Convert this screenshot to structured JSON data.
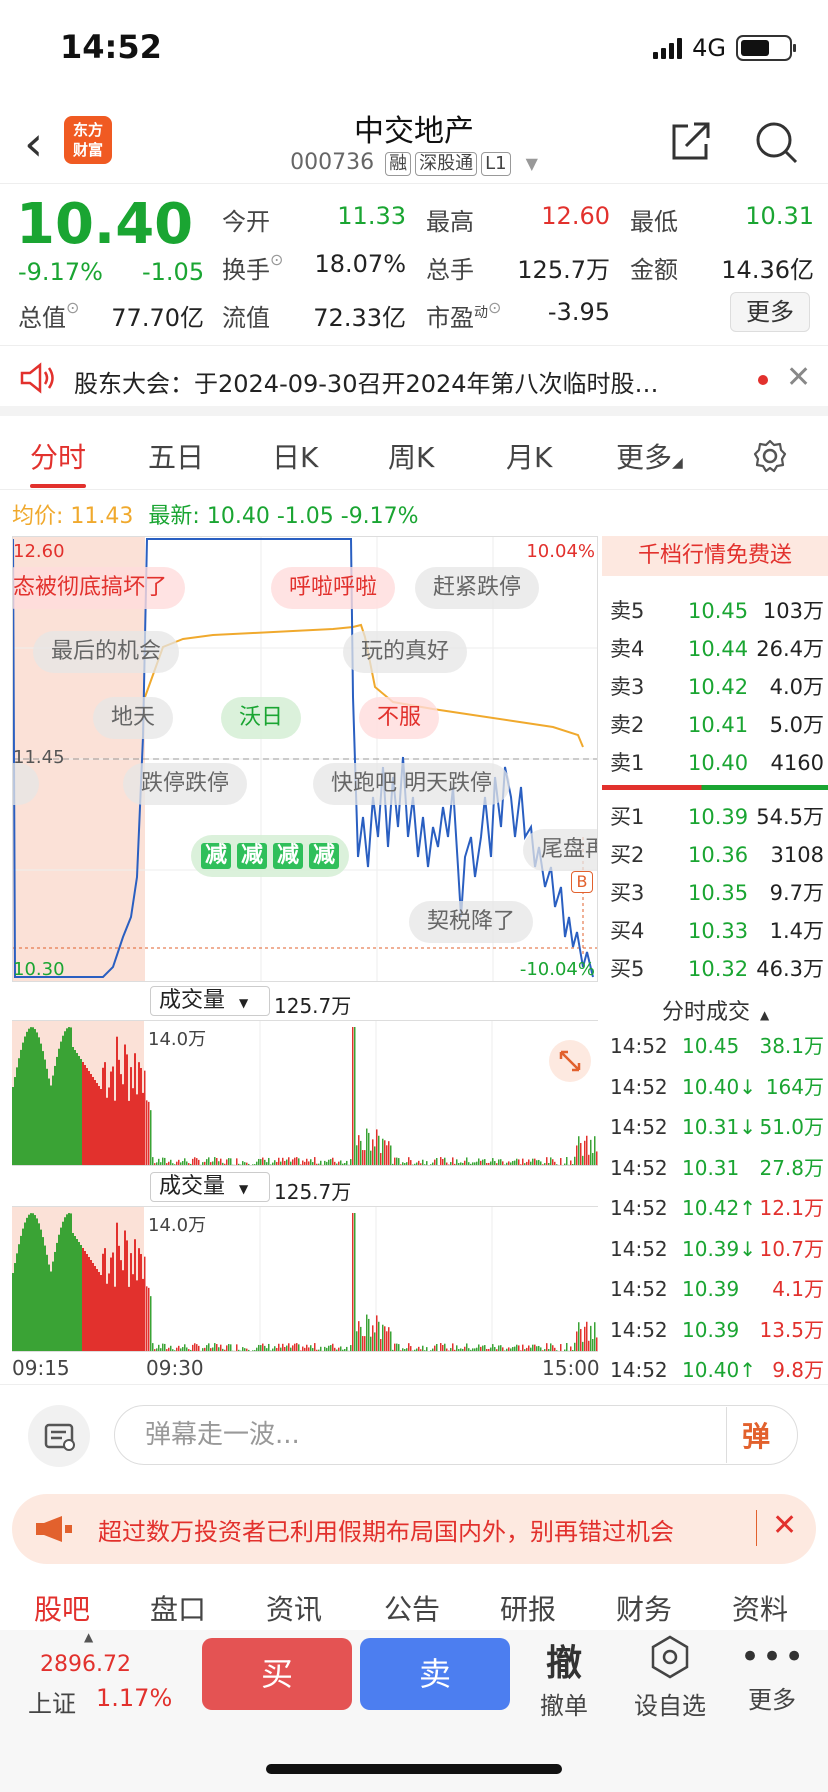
{
  "status_bar": {
    "time": "14:52",
    "network": "4G"
  },
  "header": {
    "back_icon": "chevron-left-icon",
    "logo_line1": "东方",
    "logo_line2": "财富",
    "name": "中交地产",
    "code": "000736",
    "tags": [
      "融",
      "深股通",
      "L1"
    ],
    "share_icon": "share-icon",
    "search_icon": "search-icon"
  },
  "quote": {
    "price": "10.40",
    "change_pct": "-9.17%",
    "change": "-1.05",
    "open_label": "今开",
    "open": "11.33",
    "high_label": "最高",
    "high": "12.60",
    "low_label": "最低",
    "low": "10.31",
    "turnover_label": "换手",
    "turnover": "18.07%",
    "vol_label": "总手",
    "vol": "125.7万",
    "amount_label": "金额",
    "amount": "14.36亿",
    "mktcap_label": "总值",
    "mktcap": "77.70亿",
    "float_label": "流值",
    "float": "72.33亿",
    "pe_label": "市盈",
    "pe_sup": "动",
    "pe": "-3.95",
    "more_label": "更多"
  },
  "notice": {
    "text": "股东大会：于2024-09-30召开2024年第八次临时股…"
  },
  "tabs": [
    {
      "label": "分时"
    },
    {
      "label": "五日"
    },
    {
      "label": "日K"
    },
    {
      "label": "周K"
    },
    {
      "label": "月K"
    },
    {
      "label": "更多"
    }
  ],
  "avg_line": {
    "avg_label": "均价:",
    "avg_val": "11.43",
    "latest_label": "最新:",
    "latest_val": "10.40",
    "latest_chg": "-1.05",
    "latest_pct": "-9.17%"
  },
  "chart_labels": {
    "top_left": "12.60",
    "top_right": "10.04%",
    "mid_left": "11.45",
    "bottom_left": "10.30",
    "bottom_right": "-10.04%",
    "marker_b": "B"
  },
  "danmu": [
    "态被彻底搞坏了",
    "呼啦呼啦",
    "赶紧跌停",
    "最后的机会",
    "玩的真好",
    "地天",
    "沃日",
    "不服",
    "跌停跌停",
    "快跑吧",
    "明天跌停",
    "尾盘再",
    "契税降了",
    "减",
    "减",
    "减",
    "减"
  ],
  "order_book": {
    "header": "千档行情免费送",
    "asks": [
      {
        "label": "卖5",
        "price": "10.45",
        "vol": "103万"
      },
      {
        "label": "卖4",
        "price": "10.44",
        "vol": "26.4万"
      },
      {
        "label": "卖3",
        "price": "10.42",
        "vol": "4.0万"
      },
      {
        "label": "卖2",
        "price": "10.41",
        "vol": "5.0万"
      },
      {
        "label": "卖1",
        "price": "10.40",
        "vol": "4160"
      }
    ],
    "bids": [
      {
        "label": "买1",
        "price": "10.39",
        "vol": "54.5万"
      },
      {
        "label": "买2",
        "price": "10.36",
        "vol": "3108"
      },
      {
        "label": "买3",
        "price": "10.35",
        "vol": "9.7万"
      },
      {
        "label": "买4",
        "price": "10.33",
        "vol": "1.4万"
      },
      {
        "label": "买5",
        "price": "10.32",
        "vol": "46.3万"
      }
    ],
    "ticks_header": "分时成交",
    "ticks": [
      {
        "time": "14:52",
        "price": "10.45",
        "vol": "38.1万",
        "pc": "green",
        "vc": "green"
      },
      {
        "time": "14:52",
        "price": "10.40↓",
        "vol": "164万",
        "pc": "green",
        "vc": "green"
      },
      {
        "time": "14:52",
        "price": "10.31↓",
        "vol": "51.0万",
        "pc": "green",
        "vc": "green"
      },
      {
        "time": "14:52",
        "price": "10.31",
        "vol": "27.8万",
        "pc": "green",
        "vc": "green"
      },
      {
        "time": "14:52",
        "price": "10.42↑",
        "vol": "12.1万",
        "pc": "green",
        "vc": "red"
      },
      {
        "time": "14:52",
        "price": "10.39↓",
        "vol": "10.7万",
        "pc": "green",
        "vc": "red"
      },
      {
        "time": "14:52",
        "price": "10.39",
        "vol": "4.1万",
        "pc": "green",
        "vc": "red"
      },
      {
        "time": "14:52",
        "price": "10.39",
        "vol": "13.5万",
        "pc": "green",
        "vc": "red"
      },
      {
        "time": "14:52",
        "price": "10.40↑",
        "vol": "9.8万",
        "pc": "green",
        "vc": "red"
      }
    ]
  },
  "volume": {
    "label": "成交量",
    "total": "125.7万",
    "max": "14.0万"
  },
  "time_axis": [
    "09:15",
    "09:30",
    "15:00"
  ],
  "input_bar": {
    "placeholder": "弹幕走一波...",
    "send_label": "弹"
  },
  "banner": {
    "text": "超过数万投资者已利用假期布局国内外，别再错过机会"
  },
  "bottom_tabs": [
    "股吧",
    "盘口",
    "资讯",
    "公告",
    "研报",
    "财务",
    "资料"
  ],
  "toolbar": {
    "index_value": "2896.72",
    "index_name": "上证",
    "index_pct": "1.17%",
    "buy": "买",
    "sell": "卖",
    "cancel_glyph": "撤",
    "cancel": "撤单",
    "watch": "设自选",
    "more": "更多"
  },
  "colors": {
    "up": "#e2312d",
    "down": "#1aa532",
    "price_line": "#2a5fc1",
    "avg_line": "#f0a92d"
  }
}
